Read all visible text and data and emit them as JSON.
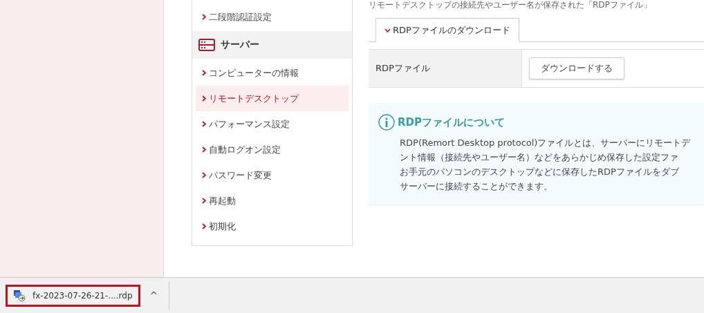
{
  "intro_text": "リモートデスクトップの接続先やユーザー名が保存された「RDPファイル」",
  "sidebar": {
    "items": [
      {
        "kind": "link",
        "label": "二段階認証設定",
        "selected": false
      },
      {
        "kind": "section",
        "label": "サーバー"
      },
      {
        "kind": "link",
        "label": "コンピューターの情報",
        "selected": false
      },
      {
        "kind": "link",
        "label": "リモートデスクトップ",
        "selected": true
      },
      {
        "kind": "link",
        "label": "パフォーマンス設定",
        "selected": false
      },
      {
        "kind": "link",
        "label": "自動ログオン設定",
        "selected": false
      },
      {
        "kind": "link",
        "label": "パスワード変更",
        "selected": false
      },
      {
        "kind": "link",
        "label": "再起動",
        "selected": false
      },
      {
        "kind": "link",
        "label": "初期化",
        "selected": false
      }
    ]
  },
  "tabs": [
    {
      "label": "RDPファイルのダウンロード",
      "selected": true
    }
  ],
  "table": {
    "rows": [
      {
        "label": "RDPファイル",
        "button": "ダウンロードする"
      }
    ]
  },
  "info": {
    "title": "RDPファイルについて",
    "lines": [
      "RDP(Remort Desktop protocol)ファイルとは、サーバーにリモートデ",
      "ント情報（接続先やユーザー名）などをあらかじめ保存した設定ファ",
      "お手元のパソコンのデスクトップなどに保存したRDPファイルをダブ",
      "サーバーに接続することができます。"
    ]
  },
  "download_bar": {
    "file": "fx-2023-07-26-21-....rdp",
    "selected": true,
    "expand": "^"
  }
}
